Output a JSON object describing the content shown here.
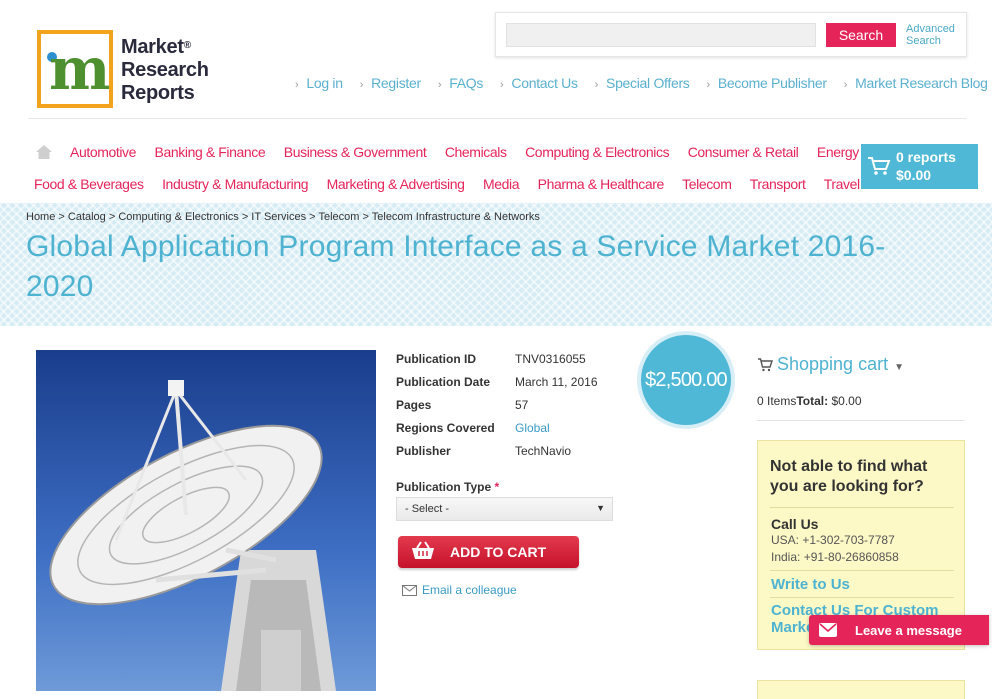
{
  "logo": {
    "line1": "Market",
    "line2": "Research",
    "line3": "Reports",
    "reg": "®",
    "mark": "m"
  },
  "search": {
    "placeholder": "",
    "button": "Search",
    "advanced_line1": "Advanced",
    "advanced_line2": "Search"
  },
  "top_links": [
    "Log in",
    "Register",
    "FAQs",
    "Contact Us",
    "Special Offers",
    "Become Publisher",
    "Market Research Blog"
  ],
  "categories_row1": [
    "Automotive",
    "Banking & Finance",
    "Business & Government",
    "Chemicals",
    "Computing & Electronics",
    "Consumer & Retail",
    "Energy & Utilities"
  ],
  "categories_row2": [
    "Food & Beverages",
    "Industry & Manufacturing",
    "Marketing & Advertising",
    "Media",
    "Pharma & Healthcare",
    "Telecom",
    "Transport",
    "Travel & Leisure"
  ],
  "cart": {
    "reports": "0 reports",
    "total": "$0.00"
  },
  "breadcrumb": "Home > Catalog > Computing & Electronics > IT Services > Telecom > Telecom Infrastructure & Networks",
  "title": "Global Application Program Interface as a Service Market 2016-2020",
  "details": {
    "publication_id": {
      "label": "Publication ID",
      "value": "TNV0316055"
    },
    "publication_date": {
      "label": "Publication Date",
      "value": "March 11, 2016"
    },
    "pages": {
      "label": "Pages",
      "value": "57"
    },
    "regions": {
      "label": "Regions Covered",
      "value": "Global"
    },
    "publisher": {
      "label": "Publisher",
      "value": "TechNavio"
    }
  },
  "publication_type": {
    "label": "Publication Type",
    "required": "*",
    "selected": "- Select -"
  },
  "add_to_cart": "ADD TO CART",
  "email_colleague": "Email a colleague",
  "price": "$2,500.00",
  "shopping_cart": {
    "title": "Shopping cart",
    "items": "0 Items",
    "total_label": "Total:",
    "total_value": "$0.00"
  },
  "help": {
    "title": "Not able to find what you are looking for?",
    "call_us": "Call Us",
    "usa": "USA: +1-302-703-7787",
    "india": "India: +91-80-26860858",
    "write": "Write to Us",
    "custom_line1": "Contact Us For Custom",
    "custom_line2": "Market"
  },
  "leave_message": "Leave a message",
  "colors": {
    "accent": "#e5245a",
    "blue": "#4eb2d1",
    "logo_orange": "#f4a41c",
    "logo_green": "#4e8f2f"
  }
}
